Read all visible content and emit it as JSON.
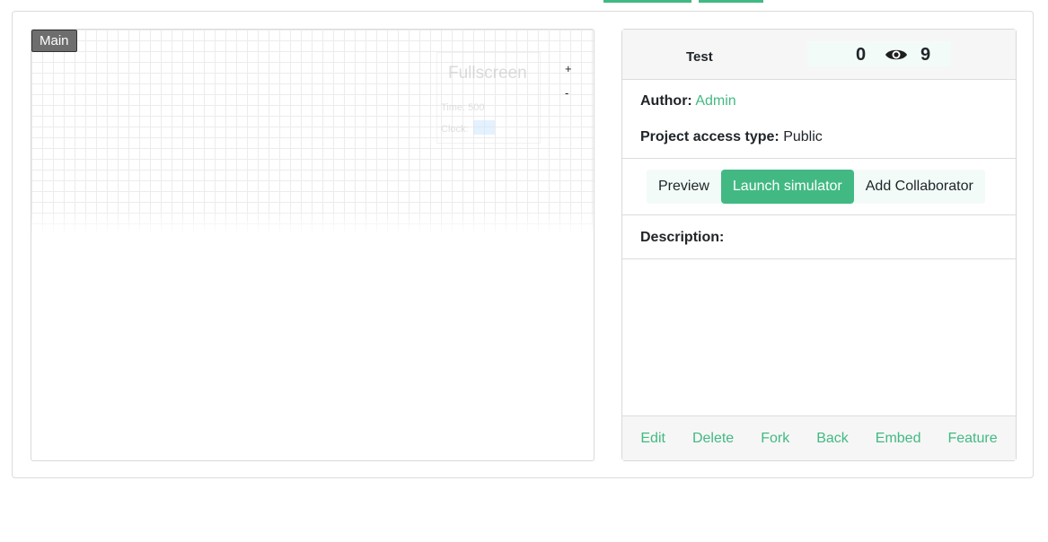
{
  "canvas": {
    "label": "Main",
    "ghost_title": "Fullscreen",
    "ghost_time": "Time: 500",
    "ghost_clock": "Clock:",
    "zoom_in": "+",
    "zoom_out": "-"
  },
  "project": {
    "name": "Test",
    "stars": "0",
    "views": "9",
    "author_label": "Author:",
    "author": "Admin",
    "access_label": "Project access type:",
    "access": "Public",
    "description_label": "Description:"
  },
  "actions": {
    "preview": "Preview",
    "launch": "Launch simulator",
    "collaborator": "Add Collaborator"
  },
  "footer": {
    "edit": "Edit",
    "delete": "Delete",
    "fork": "Fork",
    "back": "Back",
    "embed": "Embed",
    "feature": "Feature"
  },
  "colors": {
    "accent": "#42b983",
    "header_bg": "#f6f6f6"
  }
}
